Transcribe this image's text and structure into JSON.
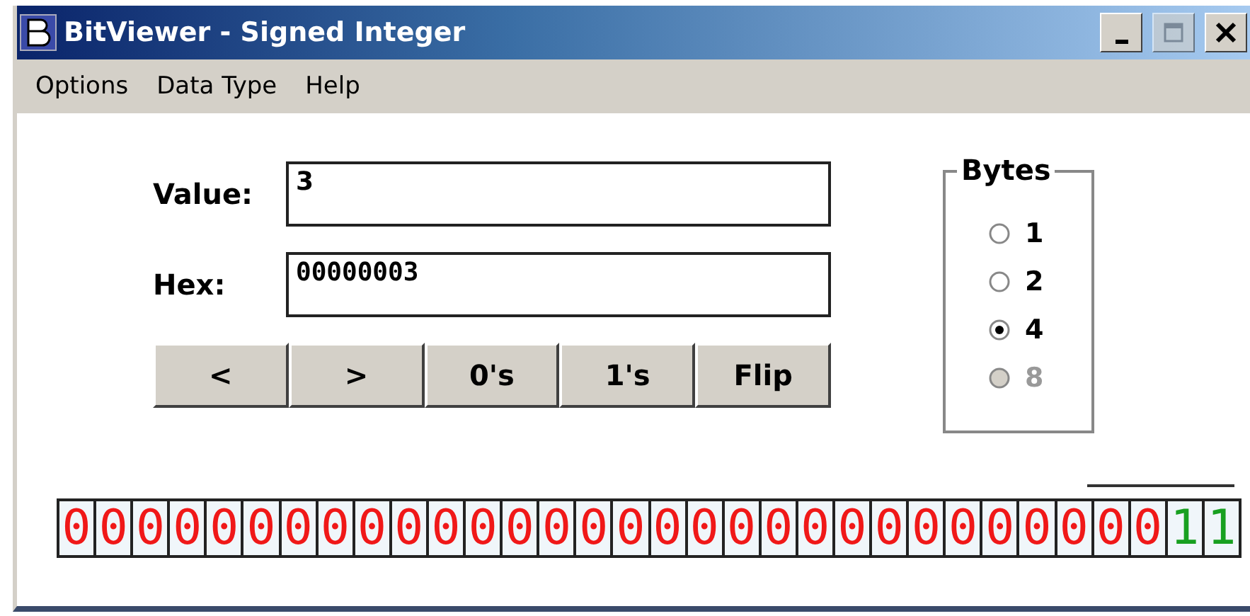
{
  "window": {
    "title": "BitViewer - Signed Integer"
  },
  "menu": [
    {
      "label": "Options"
    },
    {
      "label": "Data Type"
    },
    {
      "label": "Help"
    }
  ],
  "fields": [
    {
      "label": "Value:",
      "value": "3"
    },
    {
      "label": "Hex:",
      "value": "00000003"
    }
  ],
  "buttons": [
    {
      "label": "<"
    },
    {
      "label": ">"
    },
    {
      "label": "0's"
    },
    {
      "label": "1's"
    },
    {
      "label": "Flip"
    }
  ],
  "bytes": {
    "title": "Bytes",
    "options": [
      {
        "label": "1",
        "selected": false,
        "disabled": false
      },
      {
        "label": "2",
        "selected": false,
        "disabled": false
      },
      {
        "label": "4",
        "selected": true,
        "disabled": false
      },
      {
        "label": "8",
        "selected": false,
        "disabled": true
      }
    ]
  },
  "bits": [
    "0",
    "0",
    "0",
    "0",
    "0",
    "0",
    "0",
    "0",
    "0",
    "0",
    "0",
    "0",
    "0",
    "0",
    "0",
    "0",
    "0",
    "0",
    "0",
    "0",
    "0",
    "0",
    "0",
    "0",
    "0",
    "0",
    "0",
    "0",
    "0",
    "0",
    "1",
    "1"
  ]
}
